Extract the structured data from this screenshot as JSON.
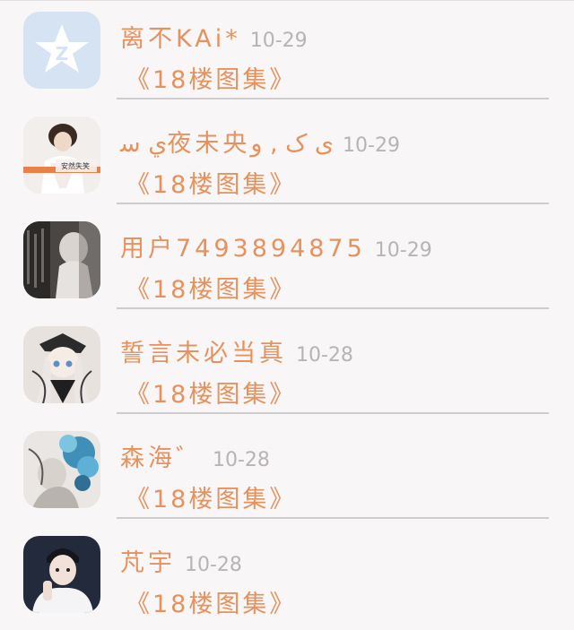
{
  "feed": {
    "items": [
      {
        "username": "离不KAi*",
        "date": "10-29",
        "group": "《18楼图集》",
        "avatar_icon": "qq-z-icon"
      },
      {
        "username": "ي ﺳ夜未央ﻯ ک , و",
        "date": "10-29",
        "group": "《18楼图集》",
        "avatar_icon": "girl-photo"
      },
      {
        "username": "用户7493894875",
        "date": "10-29",
        "group": "《18楼图集》",
        "avatar_icon": "dark-photo"
      },
      {
        "username": "誓言未必当真",
        "date": "10-28",
        "group": "《18楼图集》",
        "avatar_icon": "anime-girl"
      },
      {
        "username": "森海゛",
        "date": "10-28",
        "group": "《18楼图集》",
        "avatar_icon": "blue-flower-art"
      },
      {
        "username": "芃宇",
        "date": "10-28",
        "group": "《18楼图集》",
        "avatar_icon": "boy-photo"
      }
    ]
  },
  "colors": {
    "accent": "#e5925e",
    "date": "#b8b3b5",
    "background": "#f8f6f7",
    "divider": "#cfcccd"
  }
}
